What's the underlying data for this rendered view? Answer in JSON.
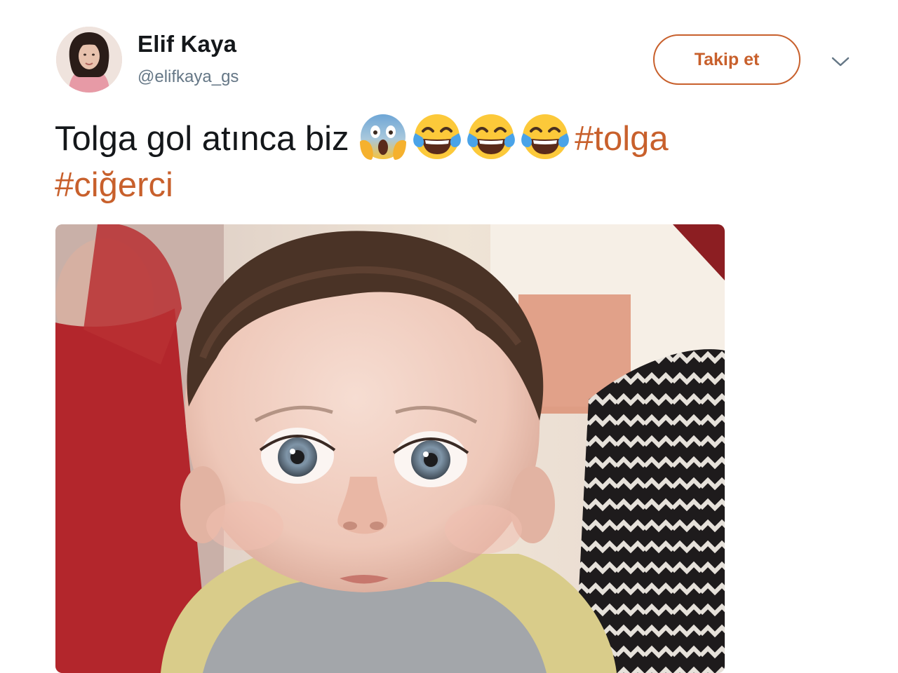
{
  "user": {
    "name": "Elif Kaya",
    "handle": "@elifkaya_gs"
  },
  "actions": {
    "follow_label": "Takip et"
  },
  "tweet": {
    "text_part1": "Tolga gol atınca biz ",
    "hashtag1": "#tolga",
    "hashtag2": "#ciğerci",
    "emojis": [
      "face-screaming-in-fear",
      "face-with-tears-of-joy",
      "face-with-tears-of-joy",
      "face-with-tears-of-joy"
    ]
  },
  "colors": {
    "accent": "#c8602c",
    "text": "#14171a",
    "secondary_text": "#657786"
  },
  "icons": {
    "menu": "chevron-down-icon"
  }
}
